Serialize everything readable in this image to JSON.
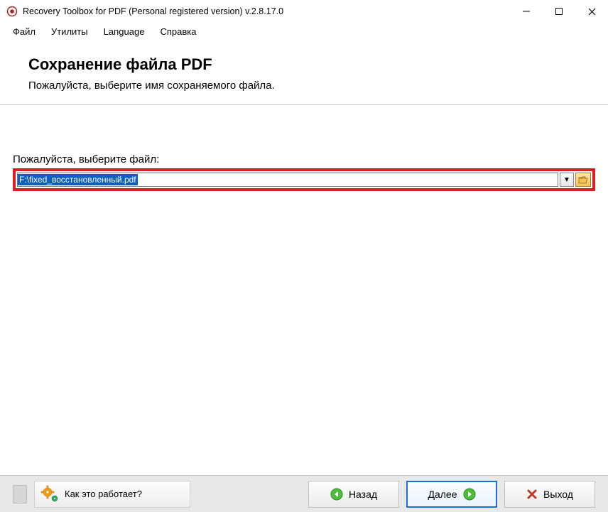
{
  "window": {
    "title": "Recovery Toolbox for PDF (Personal registered version) v.2.8.17.0"
  },
  "menu": {
    "file": "Файл",
    "utilities": "Утилиты",
    "language": "Language",
    "help": "Справка"
  },
  "header": {
    "title": "Сохранение файла PDF",
    "subtitle": "Пожалуйста, выберите имя сохраняемого файла."
  },
  "field": {
    "label": "Пожалуйста, выберите файл:",
    "value": "F:\\fixed_восстановленный.pdf"
  },
  "footer": {
    "help": "Как это работает?",
    "back": "Назад",
    "next": "Далее",
    "exit": "Выход"
  }
}
